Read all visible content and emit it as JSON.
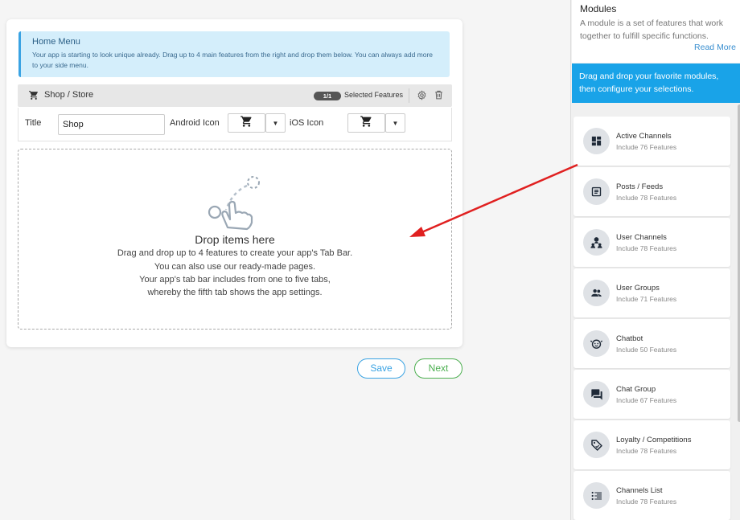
{
  "home_menu": {
    "title": "Home Menu",
    "description": "Your app is starting to look unique already. Drag up to 4 main features from the right and drop them below. You can always add more to your side menu."
  },
  "feature": {
    "name": "Shop / Store",
    "badge": "1/1",
    "selected_label": "Selected Features",
    "title_label": "Title",
    "title_value": "Shop",
    "android_icon_label": "Android Icon",
    "ios_icon_label": "iOS Icon"
  },
  "dropzone": {
    "title": "Drop items here",
    "lines": [
      "Drag and drop up to 4 features to create your app's Tab Bar.",
      "You can also use our ready-made pages.",
      "Your app's tab bar includes from one to five tabs,",
      "whereby the fifth tab shows the app settings."
    ]
  },
  "actions": {
    "save": "Save",
    "next": "Next"
  },
  "sidebar": {
    "title": "Modules",
    "description": "A module is a set of features that work together to fulfill specific functions.",
    "read_more": "Read More",
    "banner": "Drag and drop your favorite modules, then configure your selections.",
    "modules": [
      {
        "name": "Active Channels",
        "count": "Include 76 Features",
        "icon": "dashboard-icon"
      },
      {
        "name": "Posts / Feeds",
        "count": "Include 78 Features",
        "icon": "feed-icon"
      },
      {
        "name": "User Channels",
        "count": "Include 78 Features",
        "icon": "user-channels-icon"
      },
      {
        "name": "User Groups",
        "count": "Include 71 Features",
        "icon": "user-groups-icon"
      },
      {
        "name": "Chatbot",
        "count": "Include 50 Features",
        "icon": "chatbot-icon"
      },
      {
        "name": "Chat Group",
        "count": "Include 67 Features",
        "icon": "chat-icon"
      },
      {
        "name": "Loyalty / Competitions",
        "count": "Include 78 Features",
        "icon": "tag-icon"
      },
      {
        "name": "Channels List",
        "count": "Include 78 Features",
        "icon": "list-icon"
      }
    ]
  },
  "colors": {
    "accent": "#19a3e8",
    "save": "#3aa3e3",
    "next": "#4caf50",
    "arrow": "#e02020"
  }
}
